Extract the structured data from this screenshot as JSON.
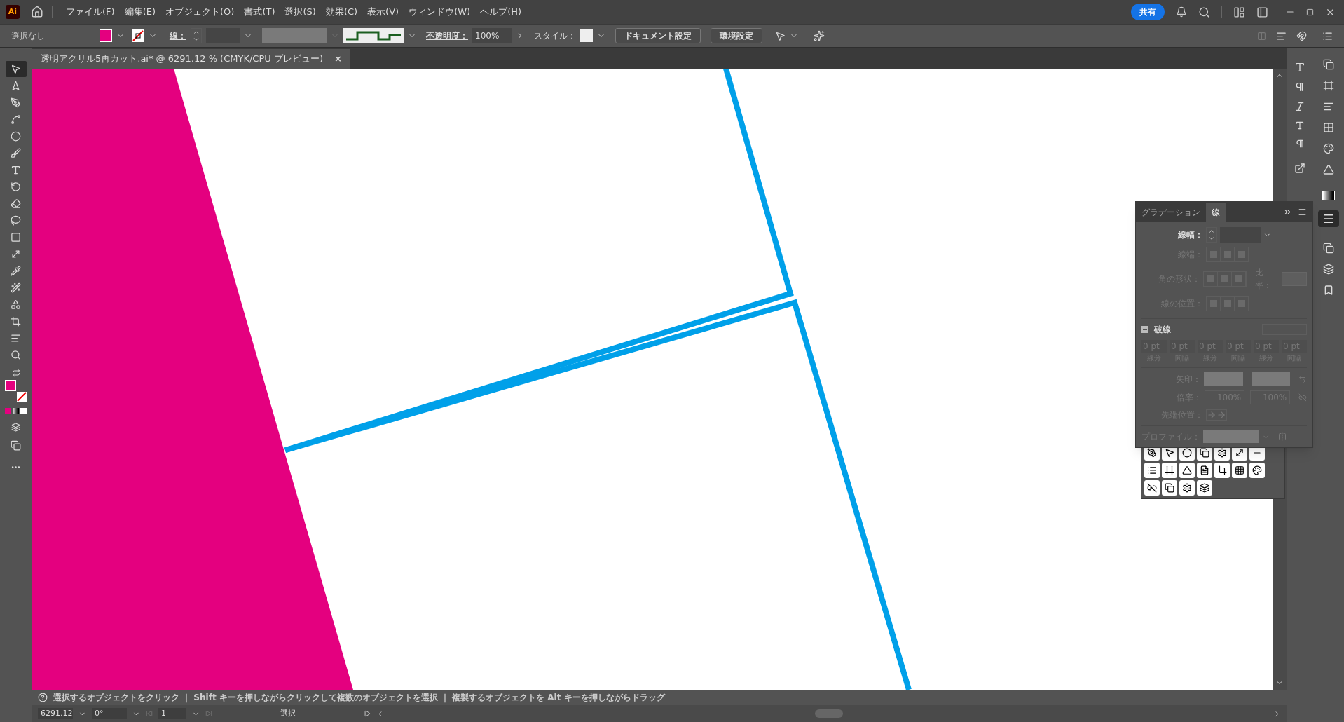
{
  "app_icon": "Ai",
  "menu": [
    "ファイル(F)",
    "編集(E)",
    "オブジェクト(O)",
    "書式(T)",
    "選択(S)",
    "効果(C)",
    "表示(V)",
    "ウィンドウ(W)",
    "ヘルプ(H)"
  ],
  "share_button": "共有",
  "control_bar": {
    "selection": "選択なし",
    "stroke_label": "線：",
    "opacity_label": "不透明度：",
    "opacity": "100%",
    "style_label": "スタイル：",
    "buttons": [
      "ドキュメント設定",
      "環境設定"
    ]
  },
  "document_tab": {
    "title": "透明アクリル5再カット.ai* @ 6291.12 % (CMYK/CPU プレビュー)",
    "close": "×"
  },
  "tools": [
    {
      "selected": true
    },
    {
      "selected": false
    },
    {
      "selected": false
    },
    {
      "selected": false
    },
    {
      "selected": false
    },
    {
      "selected": false
    },
    {
      "selected": false
    },
    {
      "selected": false
    },
    {
      "selected": false
    },
    {
      "selected": false
    },
    {
      "selected": false
    },
    {
      "selected": false
    },
    {
      "selected": false
    },
    {
      "selected": false
    },
    {
      "selected": false
    },
    {
      "selected": false
    },
    {
      "selected": false
    },
    {
      "selected": false
    }
  ],
  "stroke_panel": {
    "tabs": [
      {
        "label": "グラデーション",
        "selected": false
      },
      {
        "label": "線",
        "selected": true
      }
    ],
    "weight_label": "線幅：",
    "rows": [
      {
        "label": "線端：",
        "disabled": true
      },
      {
        "label": "角の形状：",
        "disabled": true
      },
      {
        "label": "線の位置：",
        "disabled": true
      }
    ],
    "ratio_label": "比率：",
    "dashed_label": "破線",
    "dashes": [
      {
        "value": "0 pt",
        "label": "線分"
      },
      {
        "value": "0 pt",
        "label": "間隔"
      },
      {
        "value": "0 pt",
        "label": "線分"
      },
      {
        "value": "0 pt",
        "label": "間隔"
      },
      {
        "value": "0 pt",
        "label": "線分"
      },
      {
        "value": "0 pt",
        "label": "間隔"
      }
    ],
    "arrow_label": "矢印：",
    "scale_label": "倍率：",
    "scales": [
      "100%",
      "100%"
    ],
    "align_label": "先端位置：",
    "profile_label": "プロファイル："
  },
  "status_bar": {
    "hint": "選択するオブジェクトをクリック ｜ Shift キーを押しながらクリックして複数のオブジェクトを選択 ｜ 複製するオブジェクトを Alt キーを押しながらドラッグ",
    "zoom": "6291.12",
    "rotation": "0°",
    "artboard": "1",
    "tool": "選択"
  }
}
